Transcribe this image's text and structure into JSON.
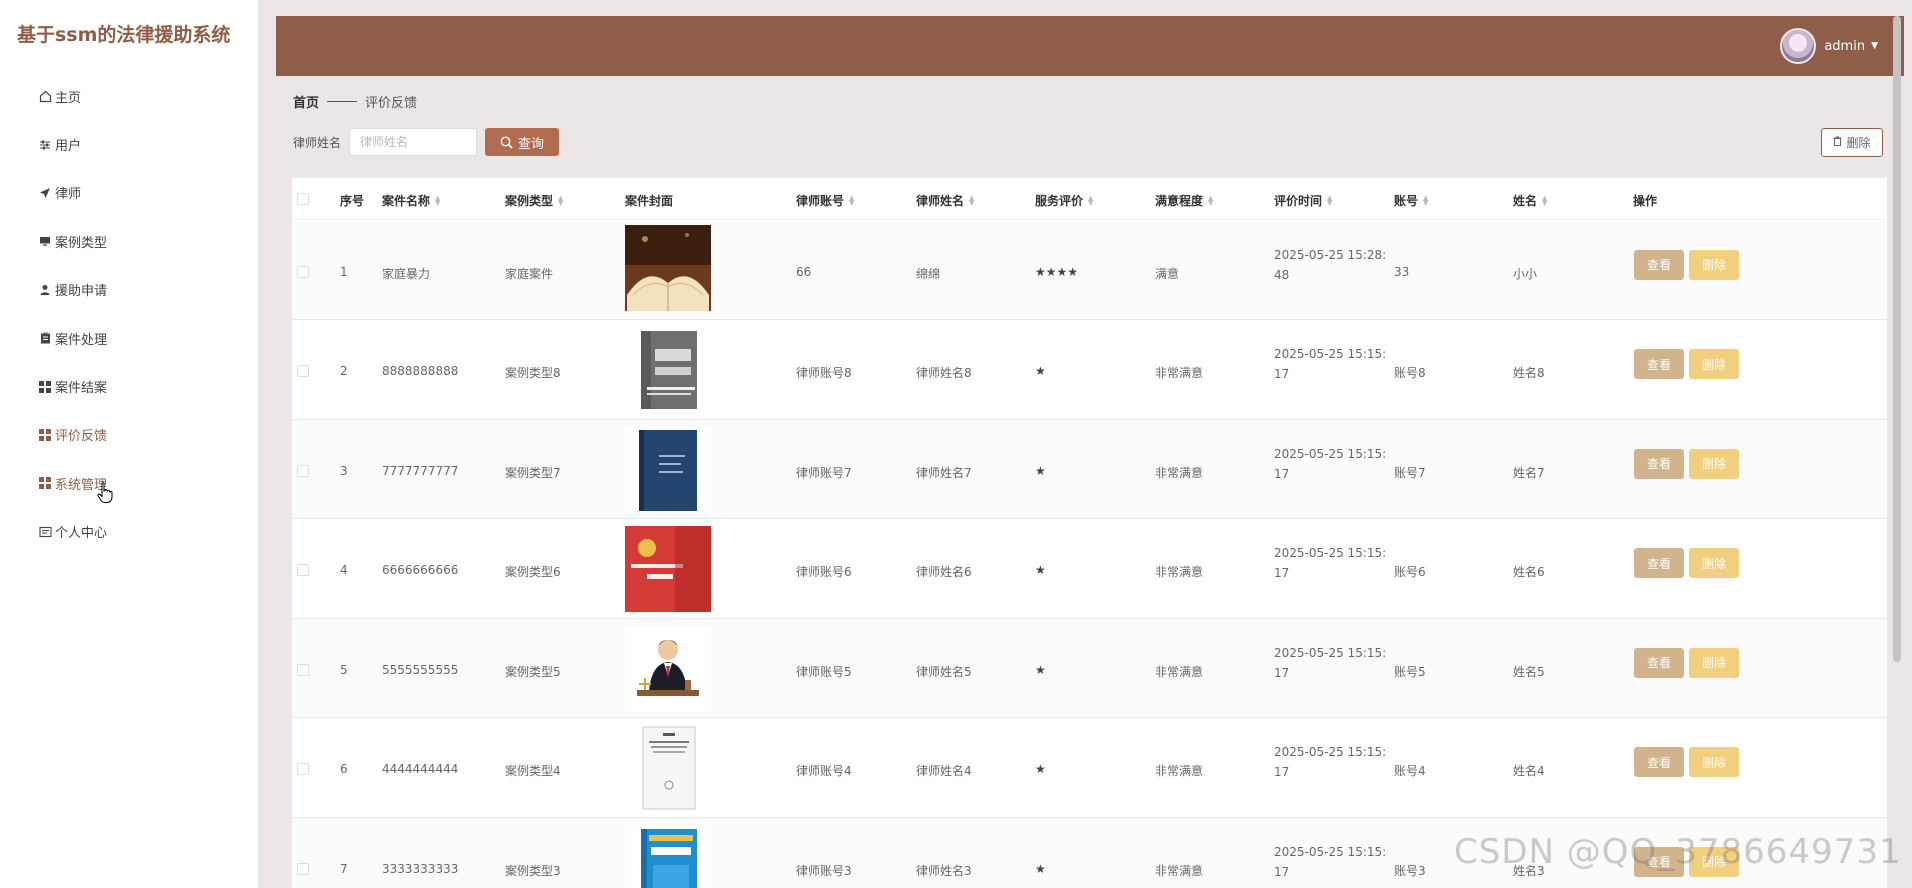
{
  "app": {
    "title": "基于ssm的法律援助系统",
    "username": "admin"
  },
  "sidebar": {
    "items": [
      {
        "label": "主页",
        "icon": "home-icon"
      },
      {
        "label": "用户",
        "icon": "sliders-icon"
      },
      {
        "label": "律师",
        "icon": "send-icon"
      },
      {
        "label": "案例类型",
        "icon": "monitor-icon"
      },
      {
        "label": "援助申请",
        "icon": "user-icon"
      },
      {
        "label": "案件处理",
        "icon": "clipboard-icon"
      },
      {
        "label": "案件结案",
        "icon": "grid-icon"
      },
      {
        "label": "评价反馈",
        "icon": "grid-icon",
        "active": true
      },
      {
        "label": "系统管理",
        "icon": "grid-icon",
        "hover": true
      },
      {
        "label": "个人中心",
        "icon": "id-card-icon"
      }
    ]
  },
  "breadcrumb": {
    "home": "首页",
    "current": "评价反馈"
  },
  "search": {
    "label": "律师姓名",
    "placeholder": "律师姓名",
    "value": "",
    "button": "查询"
  },
  "toolbar": {
    "delete_label": "删除"
  },
  "table": {
    "columns": [
      "序号",
      "案件名称",
      "案例类型",
      "案件封面",
      "律师账号",
      "律师姓名",
      "服务评价",
      "满意程度",
      "评价时间",
      "账号",
      "姓名",
      "操作"
    ],
    "sortable": [
      false,
      true,
      true,
      false,
      true,
      true,
      true,
      true,
      true,
      true,
      true,
      false
    ],
    "view_label": "查看",
    "delete_label": "删除",
    "rows": [
      {
        "no": "1",
        "case_name": "家庭暴力",
        "case_type": "家庭案件",
        "cover": "open-book-cover",
        "lawyer_account": "66",
        "lawyer_name": "绵绵",
        "rating": "★★★★",
        "satisfaction": "满意",
        "time": "2025-05-25 15:28:48",
        "account": "33",
        "name": "小小"
      },
      {
        "no": "2",
        "case_name": "8888888888",
        "case_type": "案例类型8",
        "cover": "gray-book-cover",
        "lawyer_account": "律师账号8",
        "lawyer_name": "律师姓名8",
        "rating": "★",
        "satisfaction": "非常满意",
        "time": "2025-05-25 15:15:17",
        "account": "账号8",
        "name": "姓名8"
      },
      {
        "no": "3",
        "case_name": "7777777777",
        "case_type": "案例类型7",
        "cover": "navy-book-cover",
        "lawyer_account": "律师账号7",
        "lawyer_name": "律师姓名7",
        "rating": "★",
        "satisfaction": "非常满意",
        "time": "2025-05-25 15:15:17",
        "account": "账号7",
        "name": "姓名7"
      },
      {
        "no": "4",
        "case_name": "6666666666",
        "case_type": "案例类型6",
        "cover": "red-constitution-cover",
        "lawyer_account": "律师账号6",
        "lawyer_name": "律师姓名6",
        "rating": "★",
        "satisfaction": "非常满意",
        "time": "2025-05-25 15:15:17",
        "account": "账号6",
        "name": "姓名6"
      },
      {
        "no": "5",
        "case_name": "5555555555",
        "case_type": "案例类型5",
        "cover": "judge-illustration",
        "lawyer_account": "律师账号5",
        "lawyer_name": "律师姓名5",
        "rating": "★",
        "satisfaction": "非常满意",
        "time": "2025-05-25 15:15:17",
        "account": "账号5",
        "name": "姓名5"
      },
      {
        "no": "6",
        "case_name": "4444444444",
        "case_type": "案例类型4",
        "cover": "white-book-cover",
        "lawyer_account": "律师账号4",
        "lawyer_name": "律师姓名4",
        "rating": "★",
        "satisfaction": "非常满意",
        "time": "2025-05-25 15:15:17",
        "account": "账号4",
        "name": "姓名4"
      },
      {
        "no": "7",
        "case_name": "3333333333",
        "case_type": "案例类型3",
        "cover": "blue-civil-procedure-cover",
        "lawyer_account": "律师账号3",
        "lawyer_name": "律师姓名3",
        "rating": "★",
        "satisfaction": "非常满意",
        "time": "2025-05-25 15:15:17",
        "account": "账号3",
        "name": "姓名3"
      }
    ]
  },
  "watermark": "CSDN @QQ_3786649731",
  "colors": {
    "brand": "#8e5e48",
    "search_button": "#b06b50",
    "view_button": "#d2b48c",
    "delete_button": "#f2cf7f"
  }
}
